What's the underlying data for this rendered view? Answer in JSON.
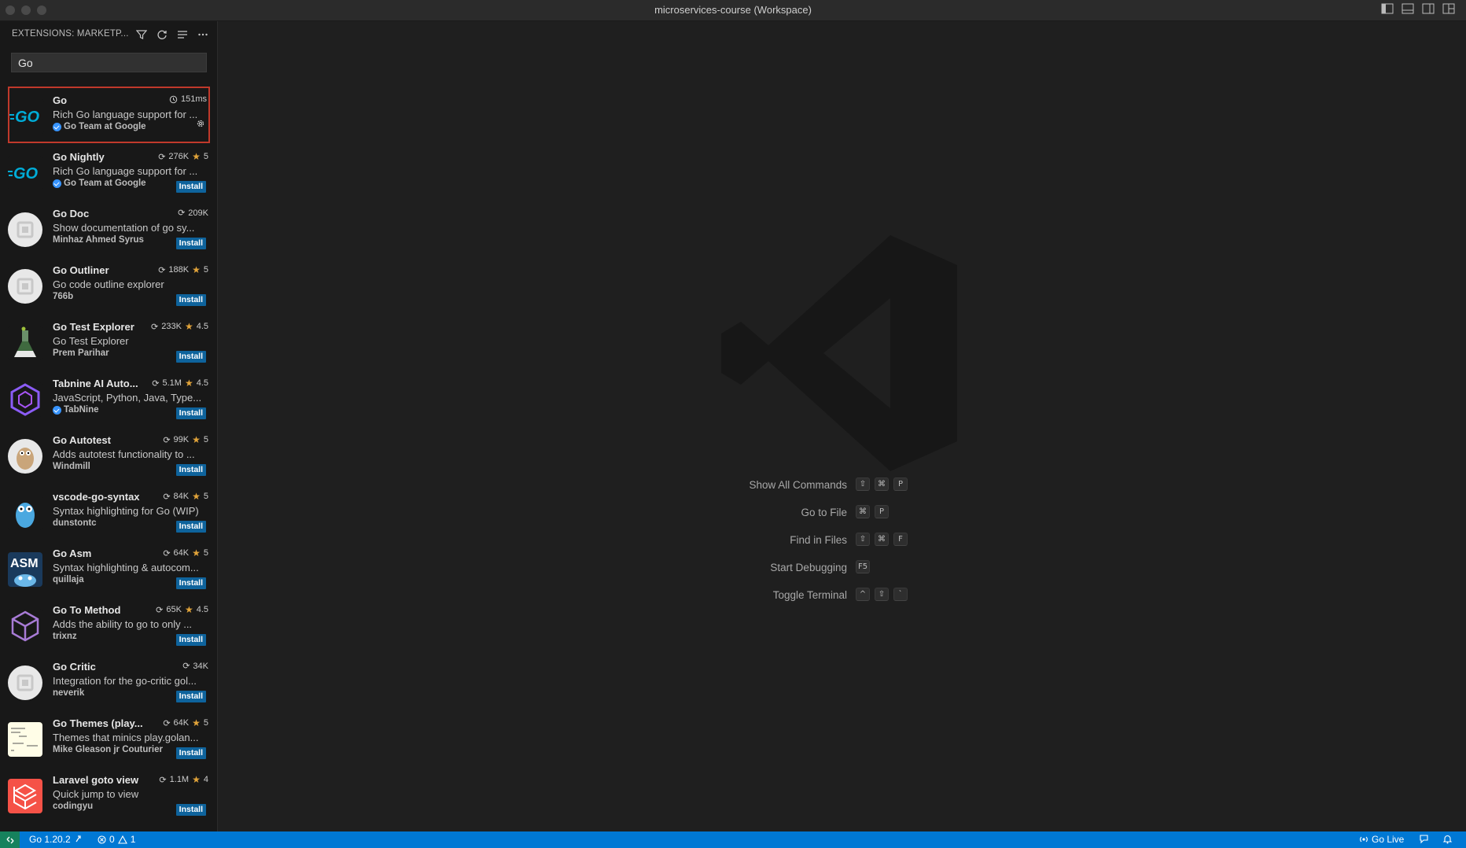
{
  "window": {
    "title": "microservices-course (Workspace)"
  },
  "sidebar": {
    "header": "EXTENSIONS: MARKETP...",
    "search_value": "Go",
    "extensions": [
      {
        "name": "Go",
        "desc": "Rich Go language support for ...",
        "publisher": "Go Team at Google",
        "verified": true,
        "stat": "151ms",
        "rating": "",
        "installed": true
      },
      {
        "name": "Go Nightly",
        "desc": "Rich Go language support for ...",
        "publisher": "Go Team at Google",
        "verified": true,
        "stat": "276K",
        "rating": "5",
        "install_label": "Install"
      },
      {
        "name": "Go Doc",
        "desc": "Show documentation of go sy...",
        "publisher": "Minhaz Ahmed Syrus",
        "verified": false,
        "stat": "209K",
        "rating": "",
        "install_label": "Install"
      },
      {
        "name": "Go Outliner",
        "desc": "Go code outline explorer",
        "publisher": "766b",
        "verified": false,
        "stat": "188K",
        "rating": "5",
        "install_label": "Install"
      },
      {
        "name": "Go Test Explorer",
        "desc": "Go Test Explorer",
        "publisher": "Prem Parihar",
        "verified": false,
        "stat": "233K",
        "rating": "4.5",
        "install_label": "Install"
      },
      {
        "name": "Tabnine AI Auto...",
        "desc": "JavaScript, Python, Java, Type...",
        "publisher": "TabNine",
        "verified": true,
        "stat": "5.1M",
        "rating": "4.5",
        "install_label": "Install"
      },
      {
        "name": "Go Autotest",
        "desc": "Adds autotest functionality to ...",
        "publisher": "Windmill",
        "verified": false,
        "stat": "99K",
        "rating": "5",
        "install_label": "Install"
      },
      {
        "name": "vscode-go-syntax",
        "desc": "Syntax highlighting for Go (WIP)",
        "publisher": "dunstontc",
        "verified": false,
        "stat": "84K",
        "rating": "5",
        "install_label": "Install"
      },
      {
        "name": "Go Asm",
        "desc": "Syntax highlighting & autocom...",
        "publisher": "quillaja",
        "verified": false,
        "stat": "64K",
        "rating": "5",
        "install_label": "Install"
      },
      {
        "name": "Go To Method",
        "desc": "Adds the ability to go to only ...",
        "publisher": "trixnz",
        "verified": false,
        "stat": "65K",
        "rating": "4.5",
        "install_label": "Install"
      },
      {
        "name": "Go Critic",
        "desc": "Integration for the go-critic gol...",
        "publisher": "neverik",
        "verified": false,
        "stat": "34K",
        "rating": "",
        "install_label": "Install"
      },
      {
        "name": "Go Themes (play...",
        "desc": "Themes that minics play.golan...",
        "publisher": "Mike Gleason jr Couturier",
        "verified": false,
        "stat": "64K",
        "rating": "5",
        "install_label": "Install"
      },
      {
        "name": "Laravel goto view",
        "desc": "Quick jump to view",
        "publisher": "codingyu",
        "verified": false,
        "stat": "1.1M",
        "rating": "4",
        "install_label": "Install"
      }
    ]
  },
  "welcome": {
    "shortcuts": [
      {
        "label": "Show All Commands",
        "keys": [
          "⇧",
          "⌘",
          "P"
        ]
      },
      {
        "label": "Go to File",
        "keys": [
          "⌘",
          "P"
        ]
      },
      {
        "label": "Find in Files",
        "keys": [
          "⇧",
          "⌘",
          "F"
        ]
      },
      {
        "label": "Start Debugging",
        "keys": [
          "F5"
        ]
      },
      {
        "label": "Toggle Terminal",
        "keys": [
          "^",
          "⇧",
          "`"
        ]
      }
    ]
  },
  "statusbar": {
    "go_version": "Go 1.20.2",
    "errors": "0",
    "warnings": "1",
    "go_live": "Go Live"
  }
}
